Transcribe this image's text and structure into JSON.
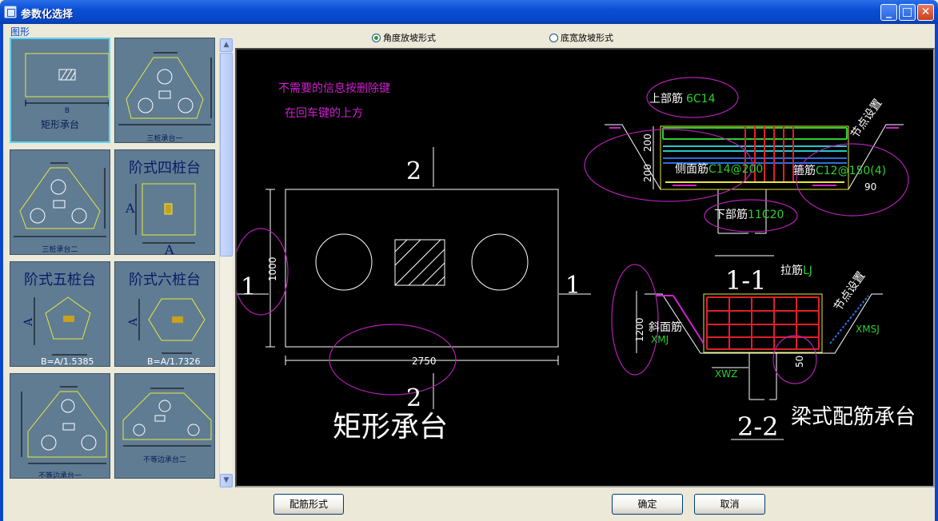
{
  "window": {
    "title": "参数化选择"
  },
  "left_panel": {
    "group_label": "图形",
    "thumbs": [
      {
        "label": "矩形承台"
      },
      {
        "label": "三桩承台一"
      },
      {
        "label": "三桩承台二"
      },
      {
        "label": "阶式四桩台"
      },
      {
        "label": "阶式五桩台",
        "formula": "B=A/1.5385"
      },
      {
        "label": "阶式六桩台",
        "formula": "B=A/1.7326"
      },
      {
        "label": "不等边承台一"
      },
      {
        "label": "不等边承台二"
      }
    ]
  },
  "radio_options": [
    {
      "label": "角度放坡形式",
      "checked": true
    },
    {
      "label": "底宽放坡形式",
      "checked": false
    }
  ],
  "drawing": {
    "note_line1": "不需要的信息按删除键",
    "note_line2": "在回车键的上方",
    "section_mark_2": "2",
    "section_mark_1": "1",
    "dim_height": "1000",
    "dim_width": "2750",
    "plan_title": "矩形承台",
    "top_bar_label": "上部筋",
    "top_bar_value": "6C14",
    "side_bar_label": "侧面筋",
    "side_bar_value": "C14@200",
    "stirrup_label": "箍筋",
    "stirrup_value": "C12@150(4)",
    "bottom_bar_label": "下部筋",
    "bottom_bar_value": "11C20",
    "node_setting": "节点设置",
    "dim_200_a": "200",
    "dim_200_b": "200",
    "angle": "90",
    "section_11": "1-1",
    "tie_label": "拉筋",
    "tie_value": "LJ",
    "slope_label": "斜面筋",
    "slope_value": "XMJ",
    "xmsj": "XMSJ",
    "dim_1200": "1200",
    "xwz": "XWZ",
    "dim_50": "50",
    "section_22": "2-2",
    "beam_title": "梁式配筋承台"
  },
  "buttons": {
    "rebar_form": "配筋形式",
    "ok": "确定",
    "cancel": "取消"
  }
}
